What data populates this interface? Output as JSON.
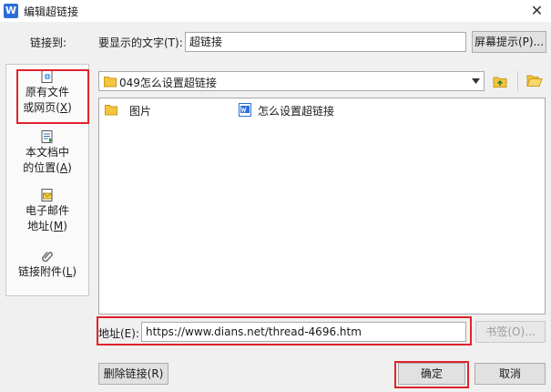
{
  "window": {
    "title": "编辑超链接",
    "app_icon_letter": "W",
    "close_glyph": "✕"
  },
  "link_to_label": "链接到:",
  "display_text": {
    "label": "要显示的文字(T):",
    "value": "超链接",
    "screentip_button": "屏幕提示(P)..."
  },
  "nav": {
    "items": [
      {
        "line1": "原有文件",
        "line2": "或网页",
        "hotkey": "X"
      },
      {
        "line1": "本文档中",
        "line2": "的位置",
        "hotkey": "A"
      },
      {
        "line1": "电子邮件",
        "line2": "地址",
        "hotkey": "M"
      },
      {
        "line1": "链接附件",
        "hotkey": "L"
      }
    ]
  },
  "folder": {
    "current": "049怎么设置超链接"
  },
  "files": [
    {
      "name": "图片",
      "type": "folder"
    },
    {
      "name": "怎么设置超链接",
      "type": "word-document"
    }
  ],
  "address": {
    "label": "地址(E):",
    "value": "https://www.dians.net/thread-4696.htm",
    "bookmark_button": "书签(O)..."
  },
  "buttons": {
    "remove_link": "删除链接(R)",
    "ok": "确定",
    "cancel": "取消"
  },
  "colors": {
    "highlight": "#e0232b",
    "folder_yellow": "#f5c542",
    "word_blue": "#2b6fd6"
  }
}
